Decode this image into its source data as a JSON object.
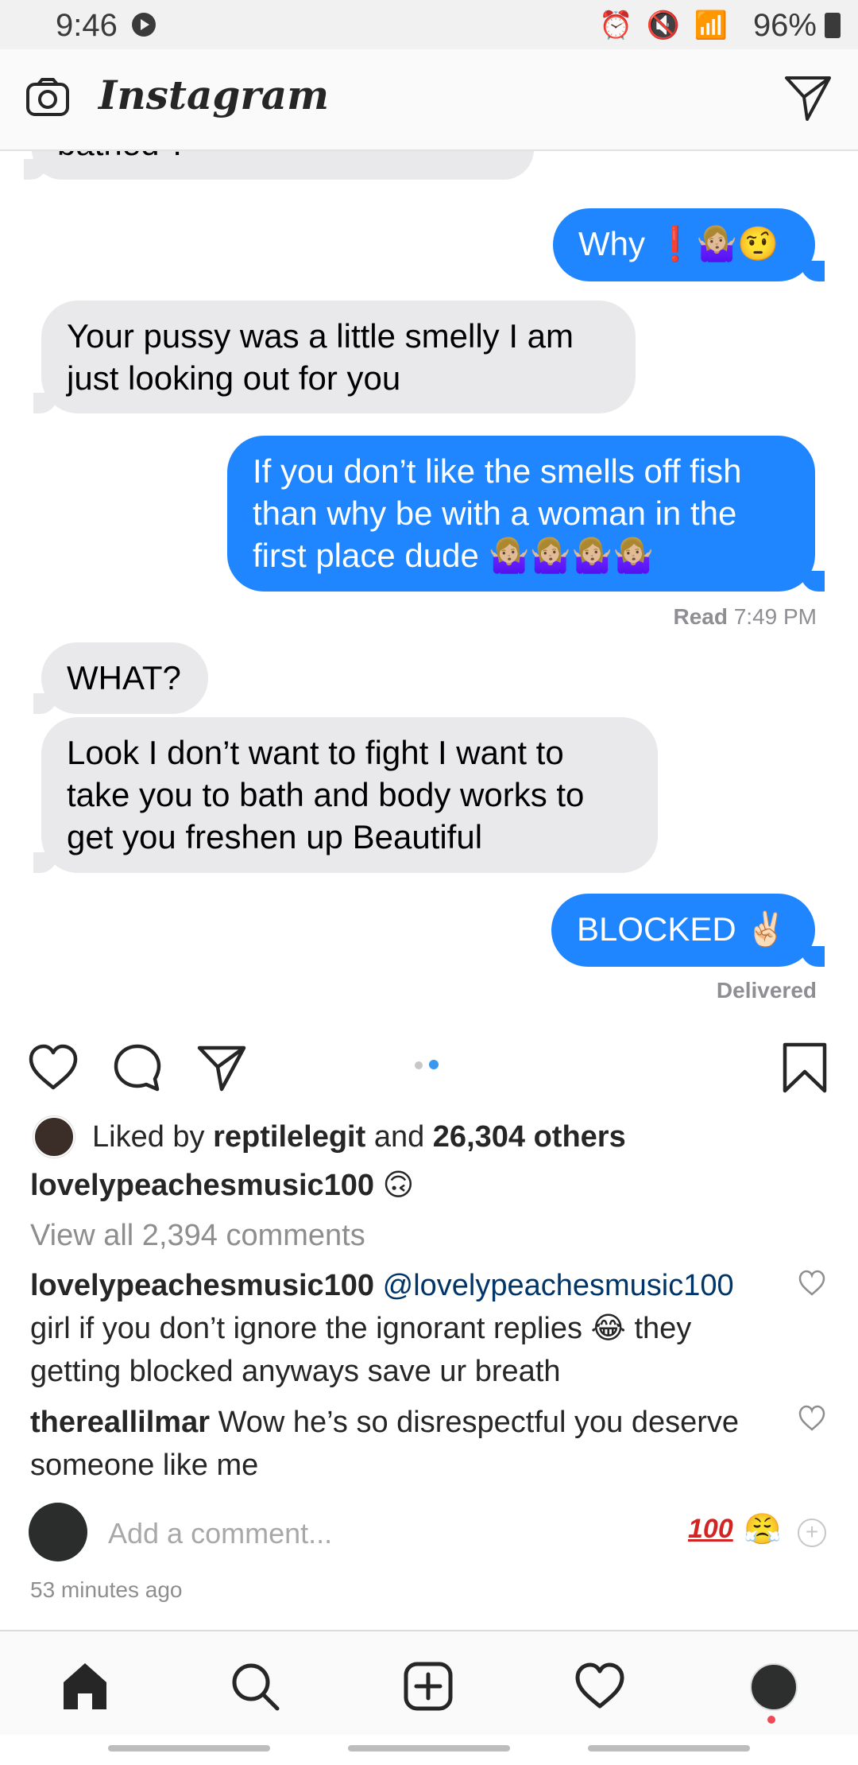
{
  "status_bar": {
    "time": "9:46",
    "icons": "⏰ 🔇 📶",
    "battery": "96%"
  },
  "header": {
    "brand": "Instagram"
  },
  "messages": [
    {
      "side": "left",
      "text": "bathed ?"
    },
    {
      "side": "right",
      "text": "Why ❗🤷🏼‍♀️🤨"
    },
    {
      "side": "left",
      "text": "Your pussy was a little smelly I am just looking out for you"
    },
    {
      "side": "right",
      "text": "If you don’t like the smells off fish than why be with a woman in the first place dude 🤷🏼‍♀️🤷🏼‍♀️🤷🏼‍♀️🤷🏼‍♀️"
    },
    {
      "side": "left",
      "text": "WHAT?"
    },
    {
      "side": "left",
      "text": "Look I don’t want to fight I want to take you to bath and body works to get you freshen up Beautiful"
    },
    {
      "side": "right",
      "text": "BLOCKED ✌🏻"
    }
  ],
  "read_receipt": {
    "label": "Read",
    "time": "7:49 PM"
  },
  "delivered": "Delivered",
  "likes": {
    "prefix": "Liked by",
    "user": "reptilelegit",
    "connector": "and",
    "others": "26,304 others"
  },
  "caption": {
    "user": "lovelypeachesmusic100",
    "emoji": "🙃"
  },
  "view_comments": "View all 2,394 comments",
  "comments": [
    {
      "user": "lovelypeachesmusic100",
      "mention": "@lovelypeachesmusic100",
      "text": "girl if you don’t ignore the ignorant replies 😂 they getting blocked anyways save ur breath"
    },
    {
      "user": "thereallilmar",
      "mention": "",
      "text": "Wow he’s so disrespectful you deserve someone like me"
    }
  ],
  "add_comment": {
    "placeholder": "Add a comment...",
    "quick_emoji_1": "100",
    "quick_emoji_2": "😤",
    "plus": "+"
  },
  "timestamp": "53 minutes ago",
  "colors": {
    "blue_bubble": "#1f86ff",
    "gray_bubble": "#e9e9eb",
    "mention": "#003569",
    "notification_dot": "#ed4956"
  }
}
